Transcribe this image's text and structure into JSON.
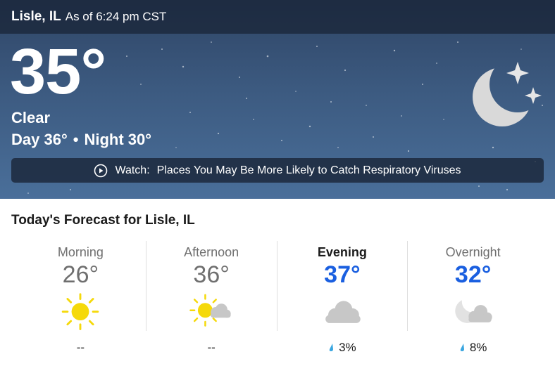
{
  "header": {
    "location": "Lisle, IL",
    "as_of": "As of 6:24 pm CST"
  },
  "current": {
    "temperature": "35°",
    "phrase": "Clear",
    "day_label": "Day 36°",
    "separator": "•",
    "night_label": "Night 30°",
    "icon": "moon-stars-icon"
  },
  "watch_banner": {
    "label": "Watch:",
    "title": "Places You May Be More Likely to Catch Respiratory Viruses",
    "icon": "play-circle-icon"
  },
  "forecast": {
    "title": "Today's Forecast for Lisle, IL",
    "periods": [
      {
        "label": "Morning",
        "temp": "26°",
        "icon": "sunny-icon",
        "precip": "--"
      },
      {
        "label": "Afternoon",
        "temp": "36°",
        "icon": "partly-cloudy-icon",
        "precip": "--"
      },
      {
        "label": "Evening",
        "temp": "37°",
        "icon": "cloudy-icon",
        "precip": "3%"
      },
      {
        "label": "Overnight",
        "temp": "32°",
        "icon": "partly-cloudy-night-icon",
        "precip": "8%"
      }
    ]
  },
  "colors": {
    "accent_blue": "#1a5fe0",
    "sun_yellow": "#f5d90a",
    "cloud_gray": "#c7c7c7",
    "drop_blue": "#3aa6e0"
  }
}
